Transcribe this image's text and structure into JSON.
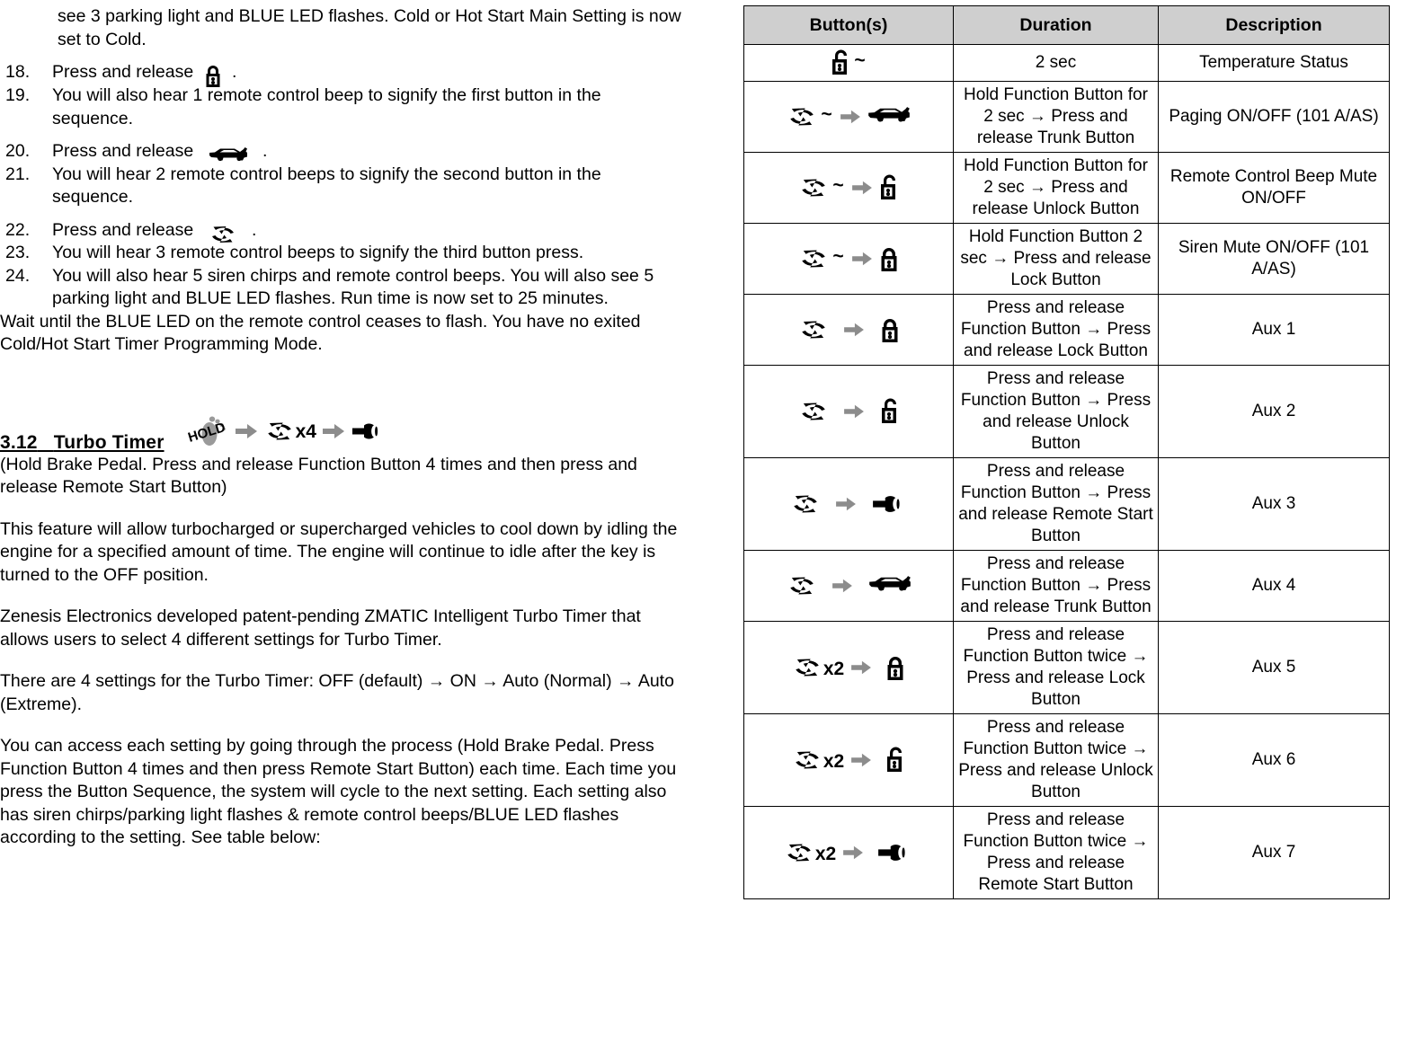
{
  "left": {
    "continuation_text": "see 3 parking light  and BLUE LED flashes.  Cold or Hot Start Main Setting is now set to Cold.",
    "steps": [
      {
        "num": "18.",
        "text_before": "Press and release",
        "icon": "lock-closed-icon",
        "text_after": "."
      },
      {
        "num": "19.",
        "text_before": "You will also hear 1 remote control beep to signify the first button in the sequence.",
        "icon": "",
        "text_after": ""
      },
      {
        "num": "20.",
        "text_before": "Press and release",
        "icon": "car-trunk-icon",
        "text_after": "."
      },
      {
        "num": "21.",
        "text_before": "You will hear 2 remote control beeps to signify the second button in the sequence.",
        "icon": "",
        "text_after": ""
      },
      {
        "num": "22.",
        "text_before": "Press and release",
        "icon": "refresh-cycle-icon",
        "text_after": "."
      },
      {
        "num": "23.",
        "text_before": "You will hear 3 remote control beeps to signify the third button press.",
        "icon": "",
        "text_after": ""
      },
      {
        "num": "24.",
        "text_before": "You will also hear 5 siren chirps and remote control beeps.  You will also see 5 parking light  and BLUE LED flashes.  Run time is now set to 25 minutes.",
        "icon": "",
        "text_after": ""
      }
    ],
    "closing_text": "Wait until the BLUE LED on the remote control ceases to flash.  You have no exited Cold/Hot Start Timer Programming Mode.",
    "section": {
      "number": "3.12",
      "title": "Turbo Timer",
      "hold_label": "HOLD",
      "multiplier": "x4",
      "subtitle": "(Hold Brake Pedal.  Press and release Function Button 4 times and then press and release Remote Start Button)"
    },
    "paragraphs": [
      "This feature will allow turbocharged or supercharged vehicles to cool down by idling the engine for a specified amount of time.  The engine will continue to idle after the key is turned to the OFF position.",
      "Zenesis Electronics developed patent-pending ZMATIC Intelligent Turbo Timer that allows users to select 4 different settings for Turbo Timer.",
      "There are 4 settings for the Turbo Timer:  OFF (default) → ON → Auto (Normal) → Auto (Extreme).",
      "You can access each setting by going through the process (Hold Brake Pedal.  Press Function Button 4 times and then press Remote Start Button) each time.  Each time you press the Button Sequence, the system will cycle to the next setting.   Each setting also has siren chirps/parking light flashes & remote control beeps/BLUE LED flashes according to the setting.  See table below:"
    ]
  },
  "table": {
    "headers": [
      "Button(s)",
      "Duration",
      "Description"
    ],
    "rows": [
      {
        "icons": [
          "lock-open-icon",
          "tilde"
        ],
        "multiplier": "",
        "duration": "2 sec",
        "description": "Temperature Status"
      },
      {
        "icons": [
          "refresh-cycle-icon",
          "tilde",
          "arrow-right-icon",
          "car-trunk-icon"
        ],
        "multiplier": "",
        "duration": "Hold Function Button for 2 sec → Press and release Trunk Button",
        "description": "Paging ON/OFF (101 A/AS)"
      },
      {
        "icons": [
          "refresh-cycle-icon",
          "tilde",
          "arrow-right-icon",
          "lock-open-icon"
        ],
        "multiplier": "",
        "duration": "Hold Function Button for 2 sec → Press and release Unlock Button",
        "description": "Remote Control Beep Mute ON/OFF"
      },
      {
        "icons": [
          "refresh-cycle-icon",
          "tilde",
          "arrow-right-icon",
          "lock-closed-icon"
        ],
        "multiplier": "",
        "duration": "Hold Function Button 2 sec → Press and release Lock Button",
        "description": "Siren Mute ON/OFF (101 A/AS)"
      },
      {
        "icons": [
          "refresh-cycle-icon",
          "arrow-right-icon",
          "lock-closed-icon"
        ],
        "multiplier": "",
        "duration": "Press and release Function Button  → Press and release Lock Button",
        "description": "Aux 1"
      },
      {
        "icons": [
          "refresh-cycle-icon",
          "arrow-right-icon",
          "lock-open-icon"
        ],
        "multiplier": "",
        "duration": "Press and release Function Button  → Press and release Unlock Button",
        "description": "Aux 2"
      },
      {
        "icons": [
          "refresh-cycle-icon",
          "arrow-right-icon",
          "remote-start-key-icon"
        ],
        "multiplier": "",
        "duration": "Press and release Function Button  → Press and release Remote Start Button",
        "description": "Aux 3"
      },
      {
        "icons": [
          "refresh-cycle-icon",
          "arrow-right-icon",
          "car-trunk-icon"
        ],
        "multiplier": "",
        "duration": "Press and release Function Button  → Press and release Trunk Button",
        "description": "Aux 4"
      },
      {
        "icons": [
          "refresh-cycle-icon",
          "x2",
          "arrow-right-icon",
          "lock-closed-icon"
        ],
        "multiplier": "x2",
        "duration": "Press and release Function Button twice → Press and release Lock Button",
        "description": "Aux 5"
      },
      {
        "icons": [
          "refresh-cycle-icon",
          "x2",
          "arrow-right-icon",
          "lock-open-icon"
        ],
        "multiplier": "x2",
        "duration": "Press and release Function Button twice → Press and release Unlock Button",
        "description": "Aux 6"
      },
      {
        "icons": [
          "refresh-cycle-icon",
          "x2",
          "arrow-right-icon",
          "remote-start-key-icon"
        ],
        "multiplier": "x2",
        "duration": "Press and release Function Button twice → Press and release Remote Start Button",
        "description": "Aux 7"
      }
    ]
  },
  "colors": {
    "header_bg": "#cfcfcf",
    "border": "#000000",
    "arrow_gray": "#8c8c8c",
    "text": "#000000"
  }
}
